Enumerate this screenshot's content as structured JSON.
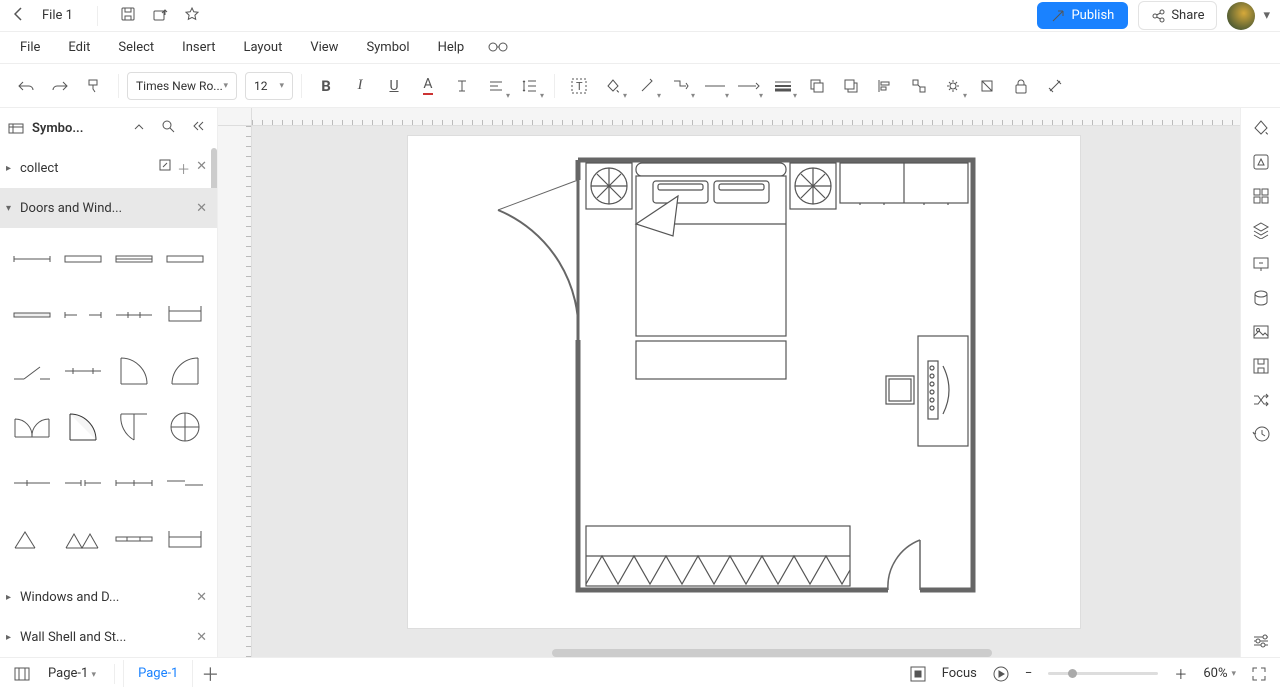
{
  "title": "File 1",
  "topActions": {
    "publish": "Publish",
    "share": "Share"
  },
  "menus": [
    "File",
    "Edit",
    "Select",
    "Insert",
    "Layout",
    "View",
    "Symbol",
    "Help"
  ],
  "toolbar": {
    "font": "Times New Ro...",
    "fontSize": "12"
  },
  "leftPanel": {
    "title": "Symbo...",
    "sections": {
      "collect": "collect",
      "doors": "Doors and Wind...",
      "windowsDoors": "Windows and D...",
      "wallShell": "Wall Shell and St..."
    }
  },
  "status": {
    "pageSelector": "Page-1",
    "activeTab": "Page-1",
    "focus": "Focus",
    "zoom": "60%"
  }
}
